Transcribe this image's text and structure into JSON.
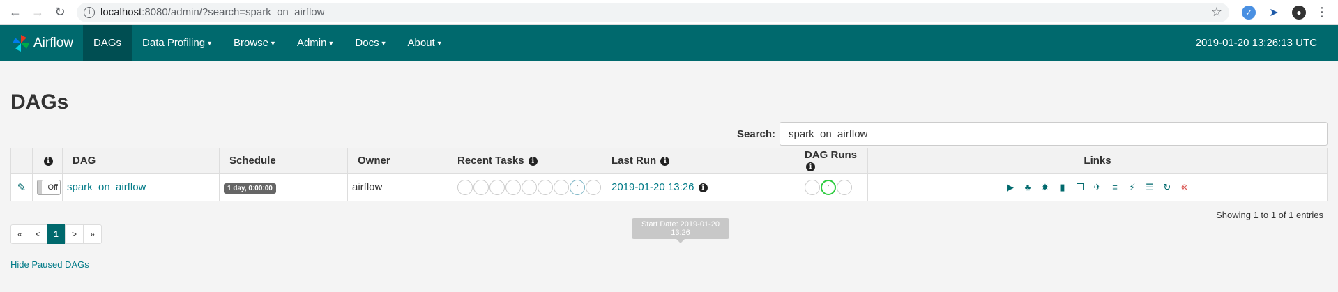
{
  "browser": {
    "url_host": "localhost",
    "url_path": ":8080/admin/?search=spark_on_airflow"
  },
  "navbar": {
    "brand": "Airflow",
    "items": [
      {
        "label": "DAGs",
        "active": true
      },
      {
        "label": "Data Profiling",
        "dropdown": true
      },
      {
        "label": "Browse",
        "dropdown": true
      },
      {
        "label": "Admin",
        "dropdown": true
      },
      {
        "label": "Docs",
        "dropdown": true
      },
      {
        "label": "About",
        "dropdown": true
      }
    ],
    "time": "2019-01-20 13:26:13 UTC"
  },
  "page": {
    "title": "DAGs",
    "search_label": "Search:",
    "search_value": "spark_on_airflow"
  },
  "table": {
    "headers": {
      "info": "",
      "dag": "DAG",
      "schedule": "Schedule",
      "owner": "Owner",
      "recent_tasks": "Recent Tasks",
      "last_run": "Last Run",
      "dag_runs": "DAG Runs",
      "links": "Links"
    },
    "rows": [
      {
        "toggle": "Off",
        "dag": "spark_on_airflow",
        "schedule": "1 day, 0:00:00",
        "owner": "airflow",
        "last_run": "2019-01-20 13:26"
      }
    ]
  },
  "tooltip": "Start Date: 2019-01-20 13:26",
  "footer": {
    "entries": "Showing 1 to 1 of 1 entries",
    "pages": [
      "«",
      "<",
      "1",
      ">",
      "»"
    ],
    "hide_paused": "Hide Paused DAGs"
  },
  "colors": {
    "navbar": "#00696d",
    "navbar_active": "#004e52",
    "link": "#007a87",
    "running": "#2ecc40"
  }
}
